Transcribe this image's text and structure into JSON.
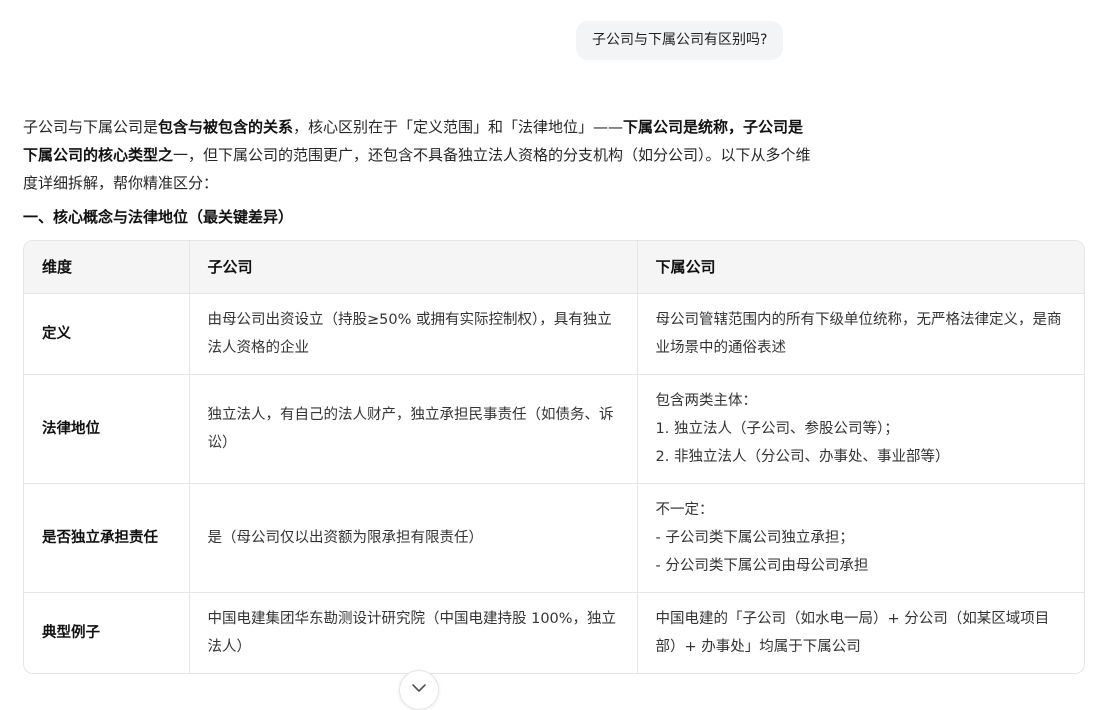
{
  "user_message": "子公司与下属公司有区别吗?",
  "intro": {
    "p1": "子公司与下属公司是",
    "b1": "包含与被包含的关系",
    "p2": "，核心区别在于「定义范围」和「法律地位」——",
    "b2": "下属公司是统称，子公司是下属公司的核心类型之",
    "p3": "一，但下属公司的范围更广，还包含不具备独立法人资格的分支机构（如分公司）。以下从多个维度详细拆解，帮你精准区分："
  },
  "section_heading": "一、核心概念与法律地位（最关键差异）",
  "table": {
    "headers": [
      "维度",
      "子公司",
      "下属公司"
    ],
    "rows": [
      {
        "dim": "定义",
        "sub": [
          "由母公司出资设立（持股≥50% 或拥有实际控制权），具有独立法人资格的企业"
        ],
        "affil": [
          "母公司管辖范围内的所有下级单位统称，无严格法律定义，是商业场景中的通俗表述"
        ]
      },
      {
        "dim": "法律地位",
        "sub": [
          "独立法人，有自己的法人财产，独立承担民事责任（如债务、诉讼）"
        ],
        "affil": [
          "包含两类主体：",
          "1. 独立法人（子公司、参股公司等）；",
          "2. 非独立法人（分公司、办事处、事业部等）"
        ]
      },
      {
        "dim": "是否独立承担责任",
        "sub": [
          "是（母公司仅以出资额为限承担有限责任）"
        ],
        "affil": [
          "不一定：",
          "- 子公司类下属公司独立承担；",
          "- 分公司类下属公司由母公司承担"
        ]
      },
      {
        "dim": "典型例子",
        "sub": [
          "中国电建集团华东勘测设计研究院（中国电建持股 100%，独立法人）"
        ],
        "affil": [
          "中国电建的「子公司（如水电一局）+ 分公司（如某区域项目部）+ 办事处」均属于下属公司"
        ]
      }
    ]
  },
  "icons": {
    "scroll_down": "chevron-down-icon"
  }
}
